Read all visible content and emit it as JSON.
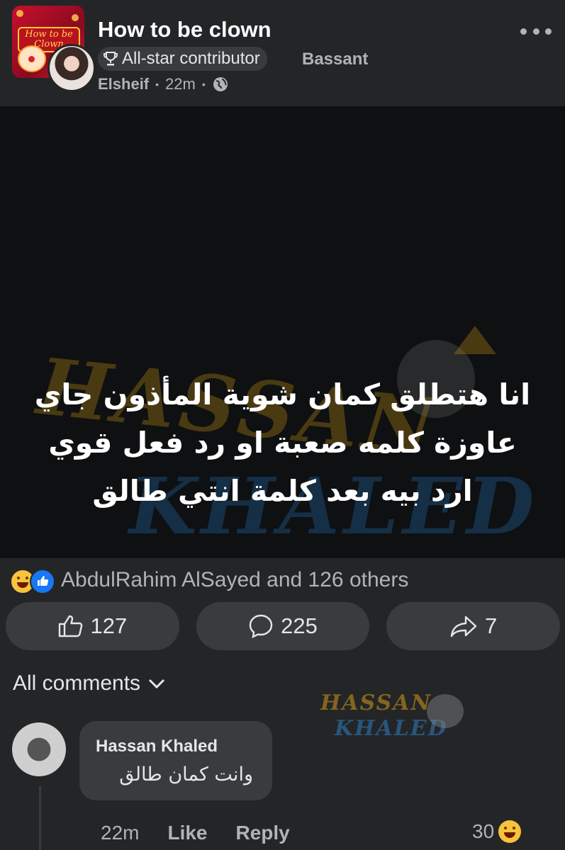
{
  "post": {
    "group_name": "How to be clown",
    "group_logo_text": "How to be Clown",
    "badge_label": "All-star contributor",
    "author_first": "Bassant",
    "author_last": "Elsheif",
    "time": "22m",
    "dot": "•",
    "text_lines": [
      "انا هتطلق كمان شوية المأذون جاي",
      "عاوزة كلمه صعبة او رد فعل قوي",
      "ارد بيه بعد كلمة انتي طالق"
    ],
    "watermark": {
      "line1": "HASSAN",
      "line2": "KHALED"
    }
  },
  "reactions": {
    "summary": "AbdulRahim AlSayed and 126 others",
    "icons": [
      "haha-icon",
      "like-icon"
    ]
  },
  "actions": {
    "like_count": "127",
    "comment_count": "225",
    "share_count": "7"
  },
  "comments": {
    "filter_label": "All comments",
    "watermark": {
      "line1": "HASSAN",
      "line2": "KHALED"
    },
    "items": [
      {
        "author": "Hassan Khaled",
        "text": "وانت كمان طالق",
        "time": "22m",
        "like_label": "Like",
        "reply_label": "Reply",
        "reaction_count": "30"
      }
    ]
  },
  "colors": {
    "background": "#242527",
    "button": "#3a3b3c",
    "image_bg": "#0f1012",
    "accent_like": "#1877f2",
    "watermark_gold": "#b98a14",
    "watermark_blue": "#1f6aa8"
  }
}
